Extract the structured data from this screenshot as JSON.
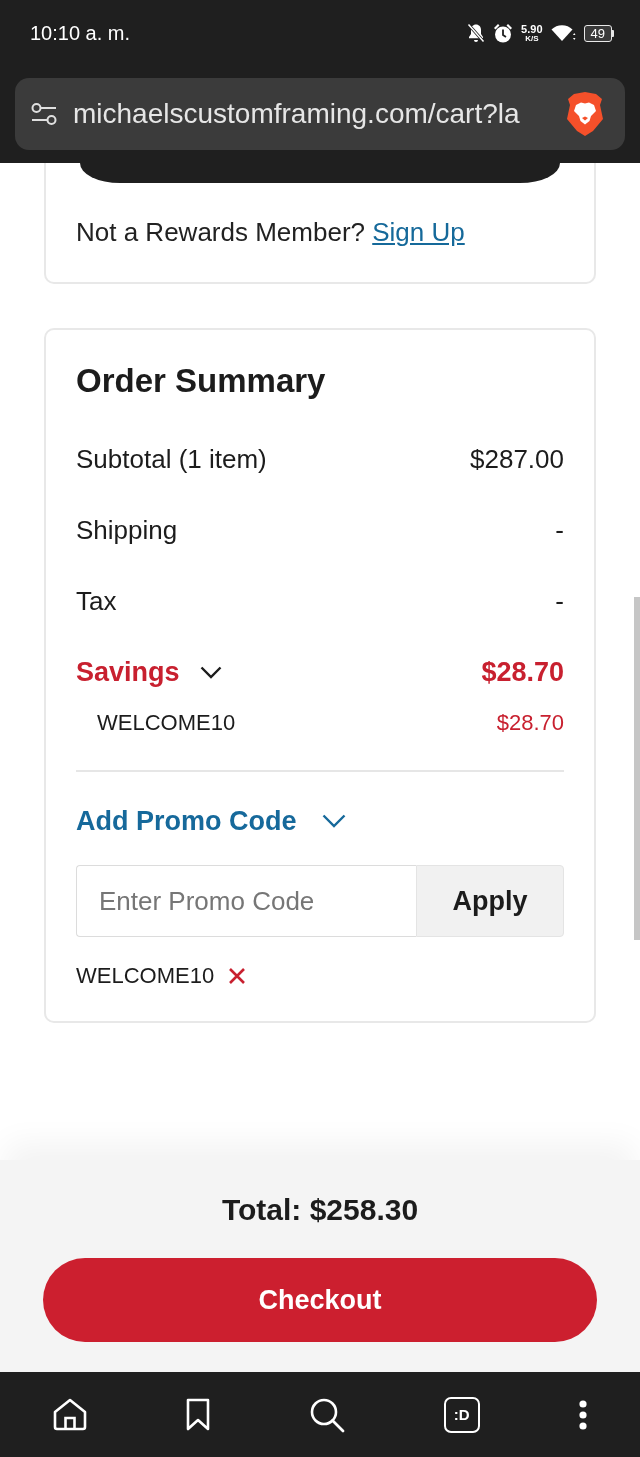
{
  "status_bar": {
    "time": "10:10 a. m.",
    "network_speed": "5.90",
    "network_speed_unit": "K/S",
    "battery": "49"
  },
  "address_bar": {
    "url": "michaelscustomframing.com/cart?la"
  },
  "rewards_card": {
    "prompt": "Not a Rewards Member?",
    "link": "Sign Up"
  },
  "order_summary": {
    "title": "Order Summary",
    "rows": [
      {
        "kind": "line",
        "label": "Subtotal (1 item)",
        "value": "$287.00"
      },
      {
        "kind": "line",
        "label": "Shipping",
        "value": "-"
      },
      {
        "kind": "line",
        "label": "Tax",
        "value": "-"
      },
      {
        "kind": "savings",
        "label": "Savings",
        "value": "$28.70",
        "expanded": true,
        "children": [
          {
            "label": "WELCOME10",
            "value": "$28.70"
          }
        ]
      }
    ],
    "promo": {
      "title": "Add Promo Code",
      "expanded": true,
      "placeholder": "Enter Promo Code",
      "button": "Apply",
      "applied_codes": [
        {
          "code": "WELCOME10"
        }
      ]
    }
  },
  "footer": {
    "total": "Total: $258.30",
    "checkout_button": "Checkout"
  },
  "nav_bar": {
    "tabs_label": ":D"
  }
}
